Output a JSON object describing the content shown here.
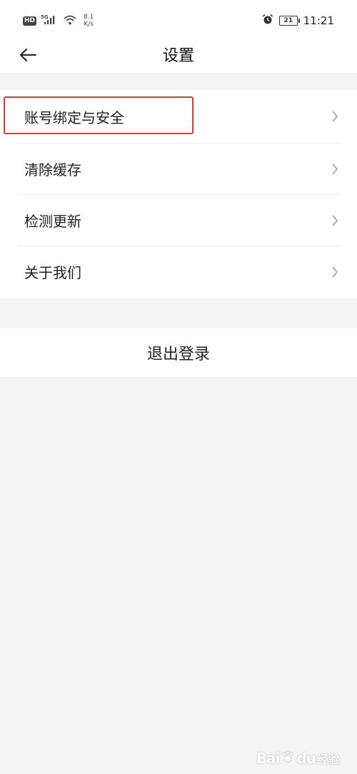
{
  "status_bar": {
    "hd": "HD",
    "network": "5G",
    "speed_value": "8.1",
    "speed_unit": "K/s",
    "battery": "21",
    "time": "11:21"
  },
  "header": {
    "title": "设置"
  },
  "menu": {
    "items": [
      {
        "label": "账号绑定与安全"
      },
      {
        "label": "清除缓存"
      },
      {
        "label": "检测更新"
      },
      {
        "label": "关于我们"
      }
    ]
  },
  "logout": {
    "label": "退出登录"
  },
  "colors": {
    "highlight": "#e53935",
    "background": "#f4f4f4"
  },
  "watermark": {
    "brand": "Bai",
    "brand_tail": "du",
    "sub": "经验"
  }
}
